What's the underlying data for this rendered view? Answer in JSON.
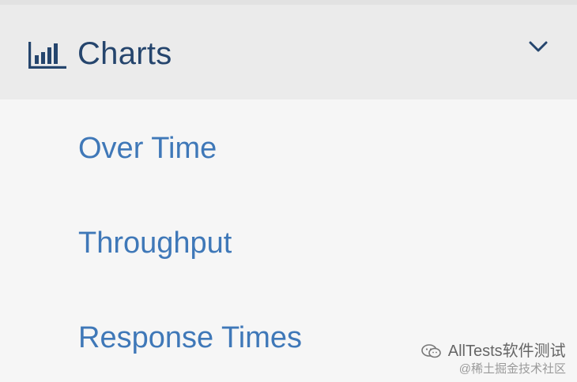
{
  "menu": {
    "header": {
      "label": "Charts",
      "icon": "bar-chart-icon",
      "toggle_icon": "chevron-down-icon",
      "expanded": true
    },
    "items": [
      {
        "label": "Over Time"
      },
      {
        "label": "Throughput"
      },
      {
        "label": "Response Times"
      }
    ]
  },
  "watermark": {
    "line1": "AllTests软件测试",
    "line2": "@稀土掘金技术社区",
    "icon": "wechat-icon"
  },
  "colors": {
    "header_text": "#25456d",
    "item_text": "#3f78b8",
    "header_bg": "#ebebeb",
    "submenu_bg": "#f6f6f6"
  }
}
